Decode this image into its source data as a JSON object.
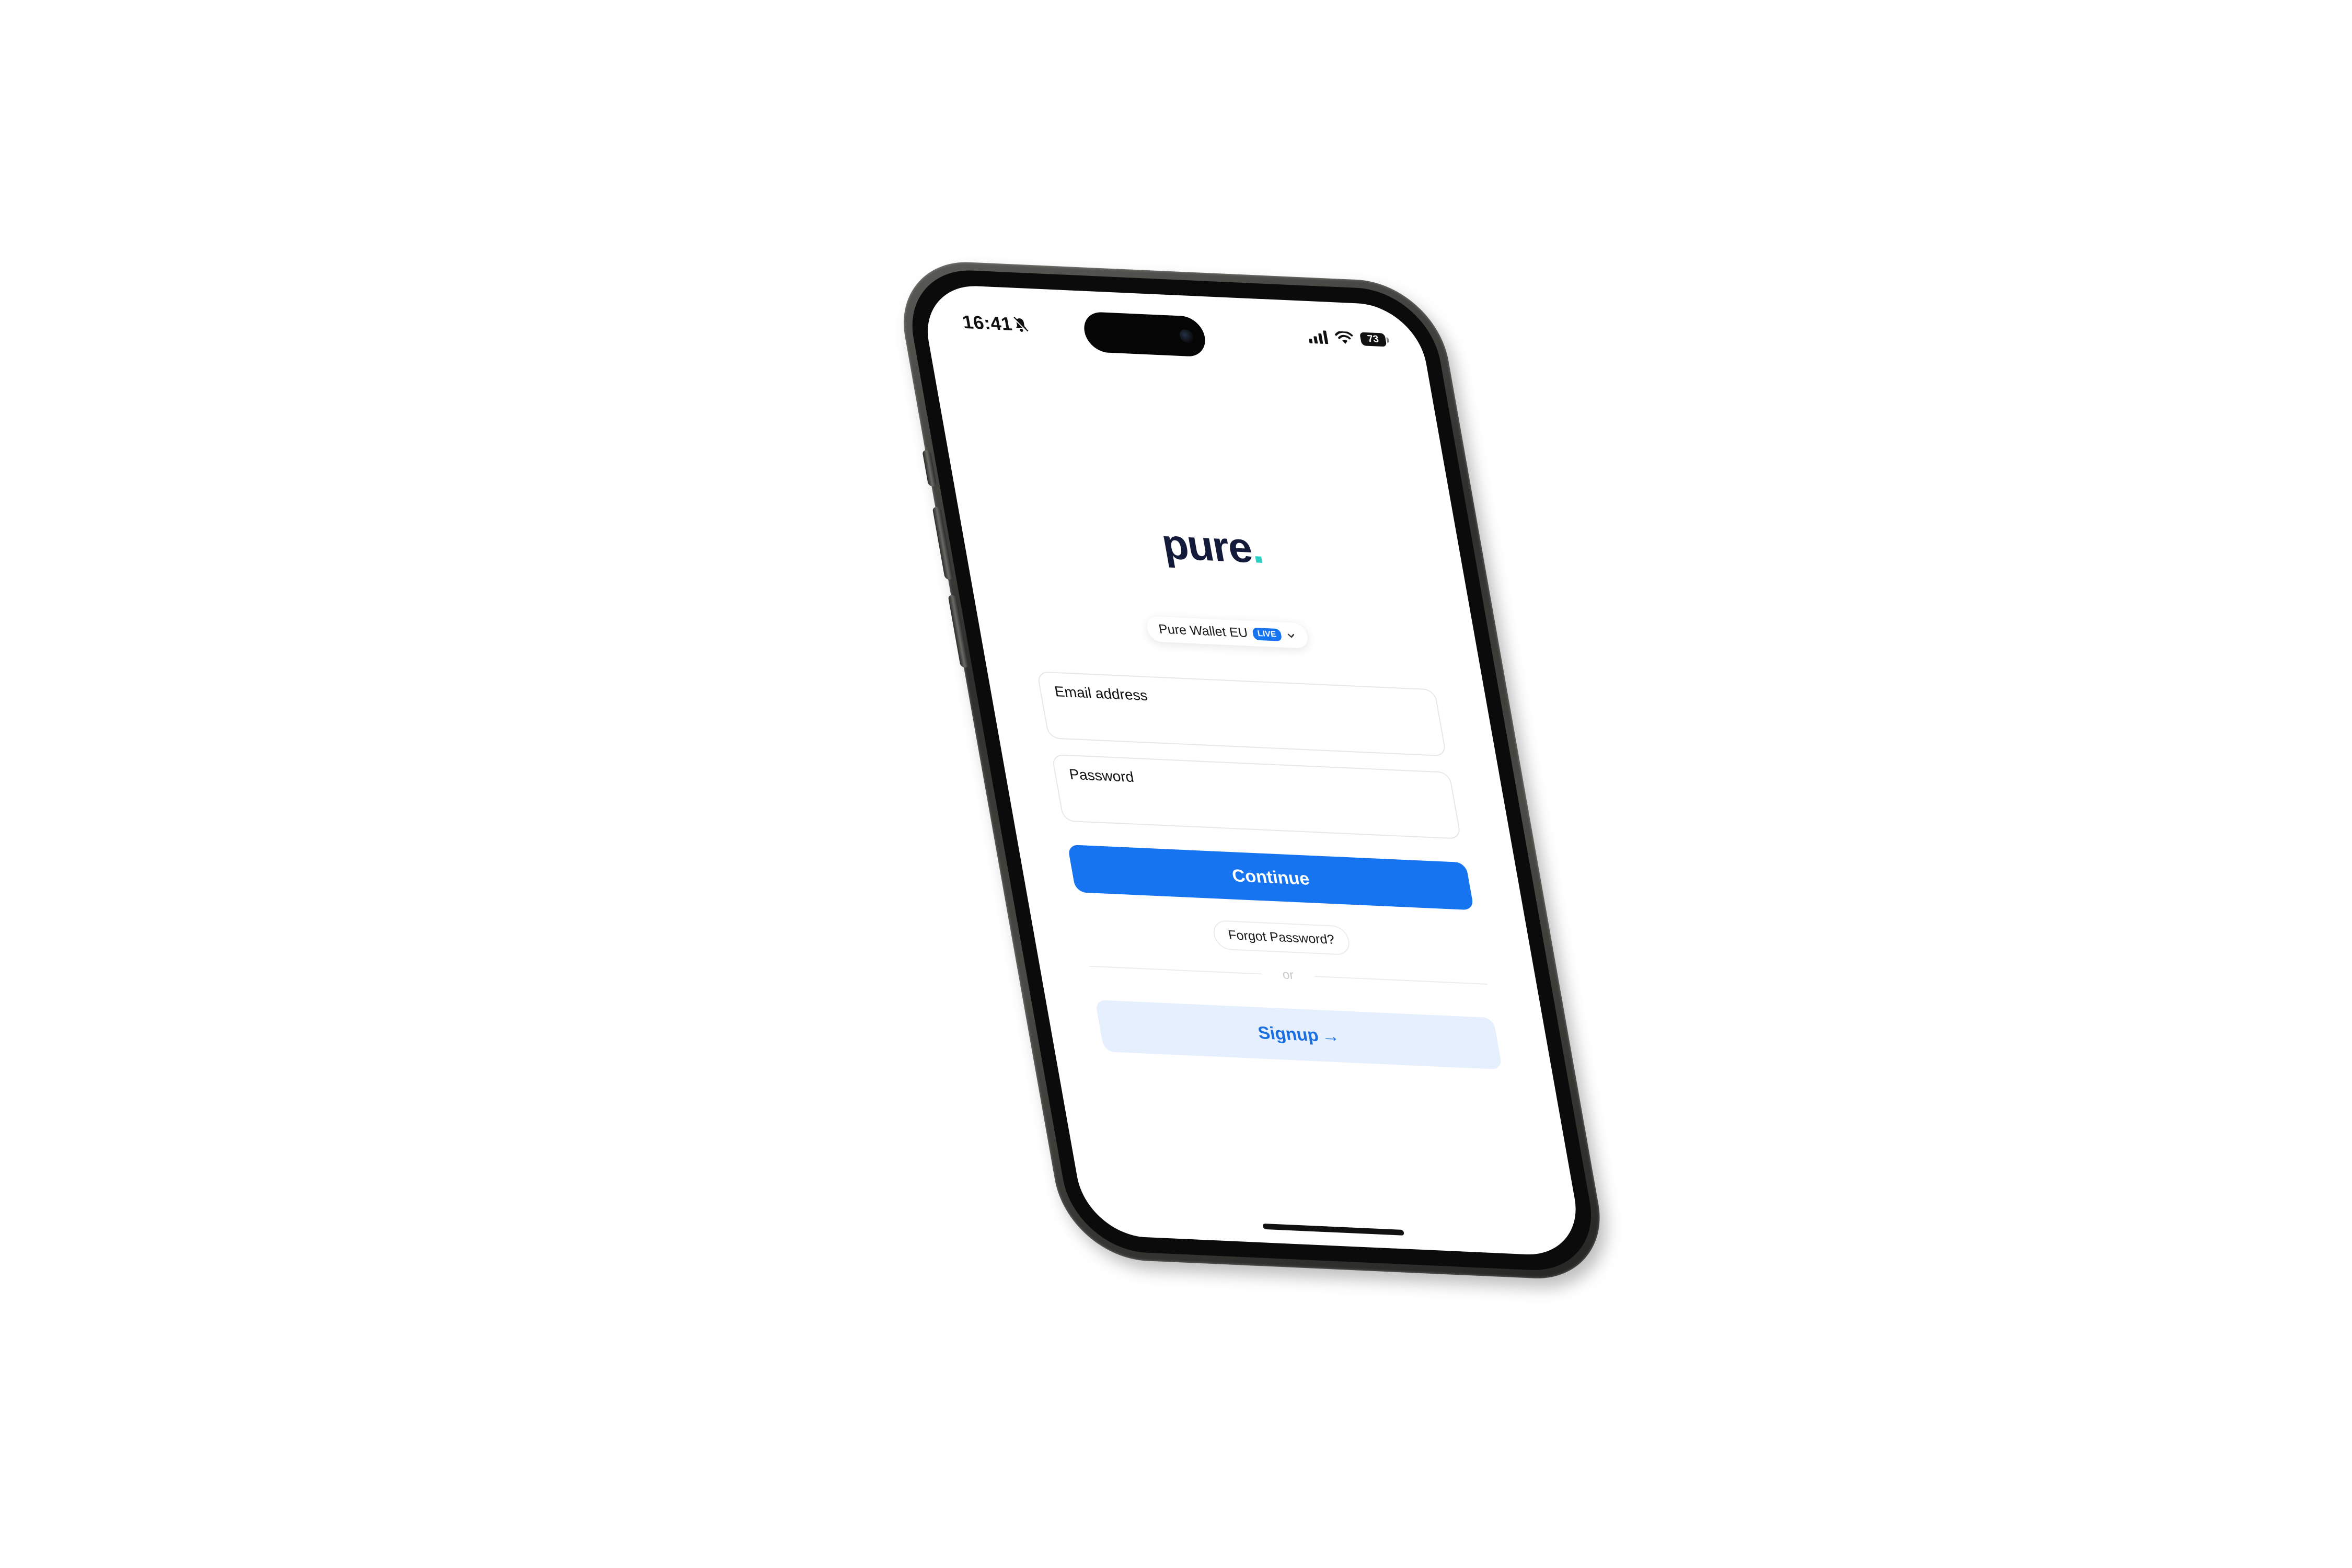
{
  "status_bar": {
    "time": "16:41",
    "battery": "73"
  },
  "logo": {
    "text": "pure",
    "dot": "."
  },
  "environment": {
    "name": "Pure Wallet EU",
    "badge": "LIVE"
  },
  "form": {
    "email_label": "Email address",
    "password_label": "Password",
    "continue_label": "Continue",
    "forgot_label": "Forgot Password?",
    "divider_text": "or",
    "signup_label": "Signup",
    "signup_arrow": "→"
  },
  "colors": {
    "primary": "#1674f0",
    "primary_soft": "#e6effd",
    "logo_text": "#141a3a",
    "logo_dot": "#2fd0c4"
  },
  "icons": {
    "bell": "bell-slash-icon",
    "signal": "cellular-signal-icon",
    "wifi": "wifi-icon",
    "battery": "battery-icon",
    "chevron": "chevron-down-icon",
    "arrow": "arrow-right-icon"
  }
}
